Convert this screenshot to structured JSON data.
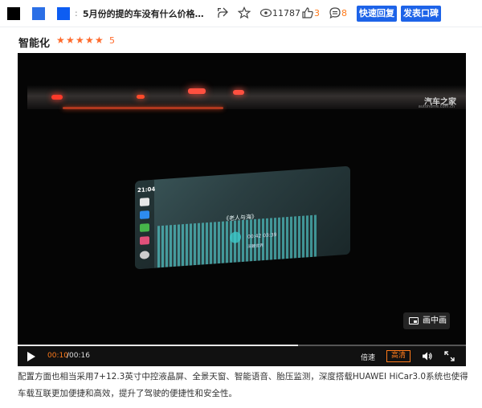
{
  "toolbar": {
    "separator": ":",
    "title": "5月份的提的车没有什么价格上的...",
    "views": "11787",
    "likes": "3",
    "comments": "8",
    "quick_reply_label": "快速回复",
    "post_praise_label": "发表口碑",
    "colors": {
      "accent": "#1d63e8",
      "orange": "#ff6a2b"
    }
  },
  "section": {
    "heading": "智能化",
    "rating_stars": 5,
    "rating_value": "5"
  },
  "video": {
    "watermark": "汽车之家",
    "watermark_sub": "autohome.com.cn",
    "screen_time": "21:04",
    "song_title": "《老人与海》",
    "song_time": "00:42   03:39",
    "song_subtitle": "深藏世界",
    "pip_label": "画中画",
    "current_time": "00:10",
    "total_time": "/00:16",
    "progress_fraction": 0.625,
    "speed_label": "倍速",
    "quality_label": "高清",
    "icons": [
      "play-icon",
      "volume-icon",
      "fullscreen-icon",
      "pip-icon"
    ]
  },
  "paragraph": "配置方面也相当采用7+12.3英寸中控液晶屏、全景天窗、智能语音、胎压监测，深度搭载HUAWEI HiCar3.0系统也使得车载互联更加便捷和高效，提升了驾驶的便捷性和安全性。"
}
